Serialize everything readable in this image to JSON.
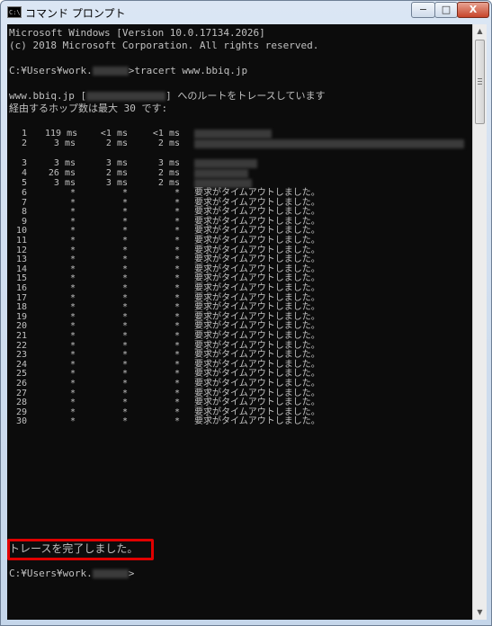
{
  "window": {
    "title": "コマンド プロンプト",
    "icon_text": "C:\\",
    "min": "−",
    "max": "□",
    "close": "X"
  },
  "console": {
    "header": [
      "Microsoft Windows [Version 10.0.17134.2026]",
      "(c) 2018 Microsoft Corporation. All rights reserved."
    ],
    "prompt1": {
      "path": "C:¥Users¥work.",
      "command": ">tracert www.bbiq.jp"
    },
    "route_line": {
      "host": "www.bbiq.jp [",
      "suffix": "] へのルートをトレースしています"
    },
    "max_hops_line": "経由するホップ数は最大 30 です:",
    "hops": [
      {
        "n": "1",
        "t1": "119 ms",
        "t2": "<1 ms",
        "t3": "<1 ms",
        "msg": ""
      },
      {
        "n": "2",
        "t1": "3 ms",
        "t2": "2 ms",
        "t3": "2 ms",
        "msg": ""
      },
      {
        "n": "3",
        "t1": "3 ms",
        "t2": "3 ms",
        "t3": "3 ms",
        "msg": ""
      },
      {
        "n": "4",
        "t1": "26 ms",
        "t2": "2 ms",
        "t3": "2 ms",
        "msg": ""
      },
      {
        "n": "5",
        "t1": "3 ms",
        "t2": "3 ms",
        "t3": "2 ms",
        "msg": ""
      },
      {
        "n": "6",
        "t1": "*",
        "t2": "*",
        "t3": "*",
        "msg": "要求がタイムアウトしました。"
      },
      {
        "n": "7",
        "t1": "*",
        "t2": "*",
        "t3": "*",
        "msg": "要求がタイムアウトしました。"
      },
      {
        "n": "8",
        "t1": "*",
        "t2": "*",
        "t3": "*",
        "msg": "要求がタイムアウトしました。"
      },
      {
        "n": "9",
        "t1": "*",
        "t2": "*",
        "t3": "*",
        "msg": "要求がタイムアウトしました。"
      },
      {
        "n": "10",
        "t1": "*",
        "t2": "*",
        "t3": "*",
        "msg": "要求がタイムアウトしました。"
      },
      {
        "n": "11",
        "t1": "*",
        "t2": "*",
        "t3": "*",
        "msg": "要求がタイムアウトしました。"
      },
      {
        "n": "12",
        "t1": "*",
        "t2": "*",
        "t3": "*",
        "msg": "要求がタイムアウトしました。"
      },
      {
        "n": "13",
        "t1": "*",
        "t2": "*",
        "t3": "*",
        "msg": "要求がタイムアウトしました。"
      },
      {
        "n": "14",
        "t1": "*",
        "t2": "*",
        "t3": "*",
        "msg": "要求がタイムアウトしました。"
      },
      {
        "n": "15",
        "t1": "*",
        "t2": "*",
        "t3": "*",
        "msg": "要求がタイムアウトしました。"
      },
      {
        "n": "16",
        "t1": "*",
        "t2": "*",
        "t3": "*",
        "msg": "要求がタイムアウトしました。"
      },
      {
        "n": "17",
        "t1": "*",
        "t2": "*",
        "t3": "*",
        "msg": "要求がタイムアウトしました。"
      },
      {
        "n": "18",
        "t1": "*",
        "t2": "*",
        "t3": "*",
        "msg": "要求がタイムアウトしました。"
      },
      {
        "n": "19",
        "t1": "*",
        "t2": "*",
        "t3": "*",
        "msg": "要求がタイムアウトしました。"
      },
      {
        "n": "20",
        "t1": "*",
        "t2": "*",
        "t3": "*",
        "msg": "要求がタイムアウトしました。"
      },
      {
        "n": "21",
        "t1": "*",
        "t2": "*",
        "t3": "*",
        "msg": "要求がタイムアウトしました。"
      },
      {
        "n": "22",
        "t1": "*",
        "t2": "*",
        "t3": "*",
        "msg": "要求がタイムアウトしました。"
      },
      {
        "n": "23",
        "t1": "*",
        "t2": "*",
        "t3": "*",
        "msg": "要求がタイムアウトしました。"
      },
      {
        "n": "24",
        "t1": "*",
        "t2": "*",
        "t3": "*",
        "msg": "要求がタイムアウトしました。"
      },
      {
        "n": "25",
        "t1": "*",
        "t2": "*",
        "t3": "*",
        "msg": "要求がタイムアウトしました。"
      },
      {
        "n": "26",
        "t1": "*",
        "t2": "*",
        "t3": "*",
        "msg": "要求がタイムアウトしました。"
      },
      {
        "n": "27",
        "t1": "*",
        "t2": "*",
        "t3": "*",
        "msg": "要求がタイムアウトしました。"
      },
      {
        "n": "28",
        "t1": "*",
        "t2": "*",
        "t3": "*",
        "msg": "要求がタイムアウトしました。"
      },
      {
        "n": "29",
        "t1": "*",
        "t2": "*",
        "t3": "*",
        "msg": "要求がタイムアウトしました。"
      },
      {
        "n": "30",
        "t1": "*",
        "t2": "*",
        "t3": "*",
        "msg": "要求がタイムアウトしました。"
      }
    ],
    "complete_message": "トレースを完了しました。",
    "prompt2": {
      "path": "C:¥Users¥work.",
      "cursor": ">"
    }
  },
  "colors": {
    "console_bg": "#0c0c0c",
    "console_fg": "#c0c0c0",
    "highlight": "#e00000"
  },
  "scrollbar": {
    "up_icon": "▲",
    "down_icon": "▼"
  }
}
